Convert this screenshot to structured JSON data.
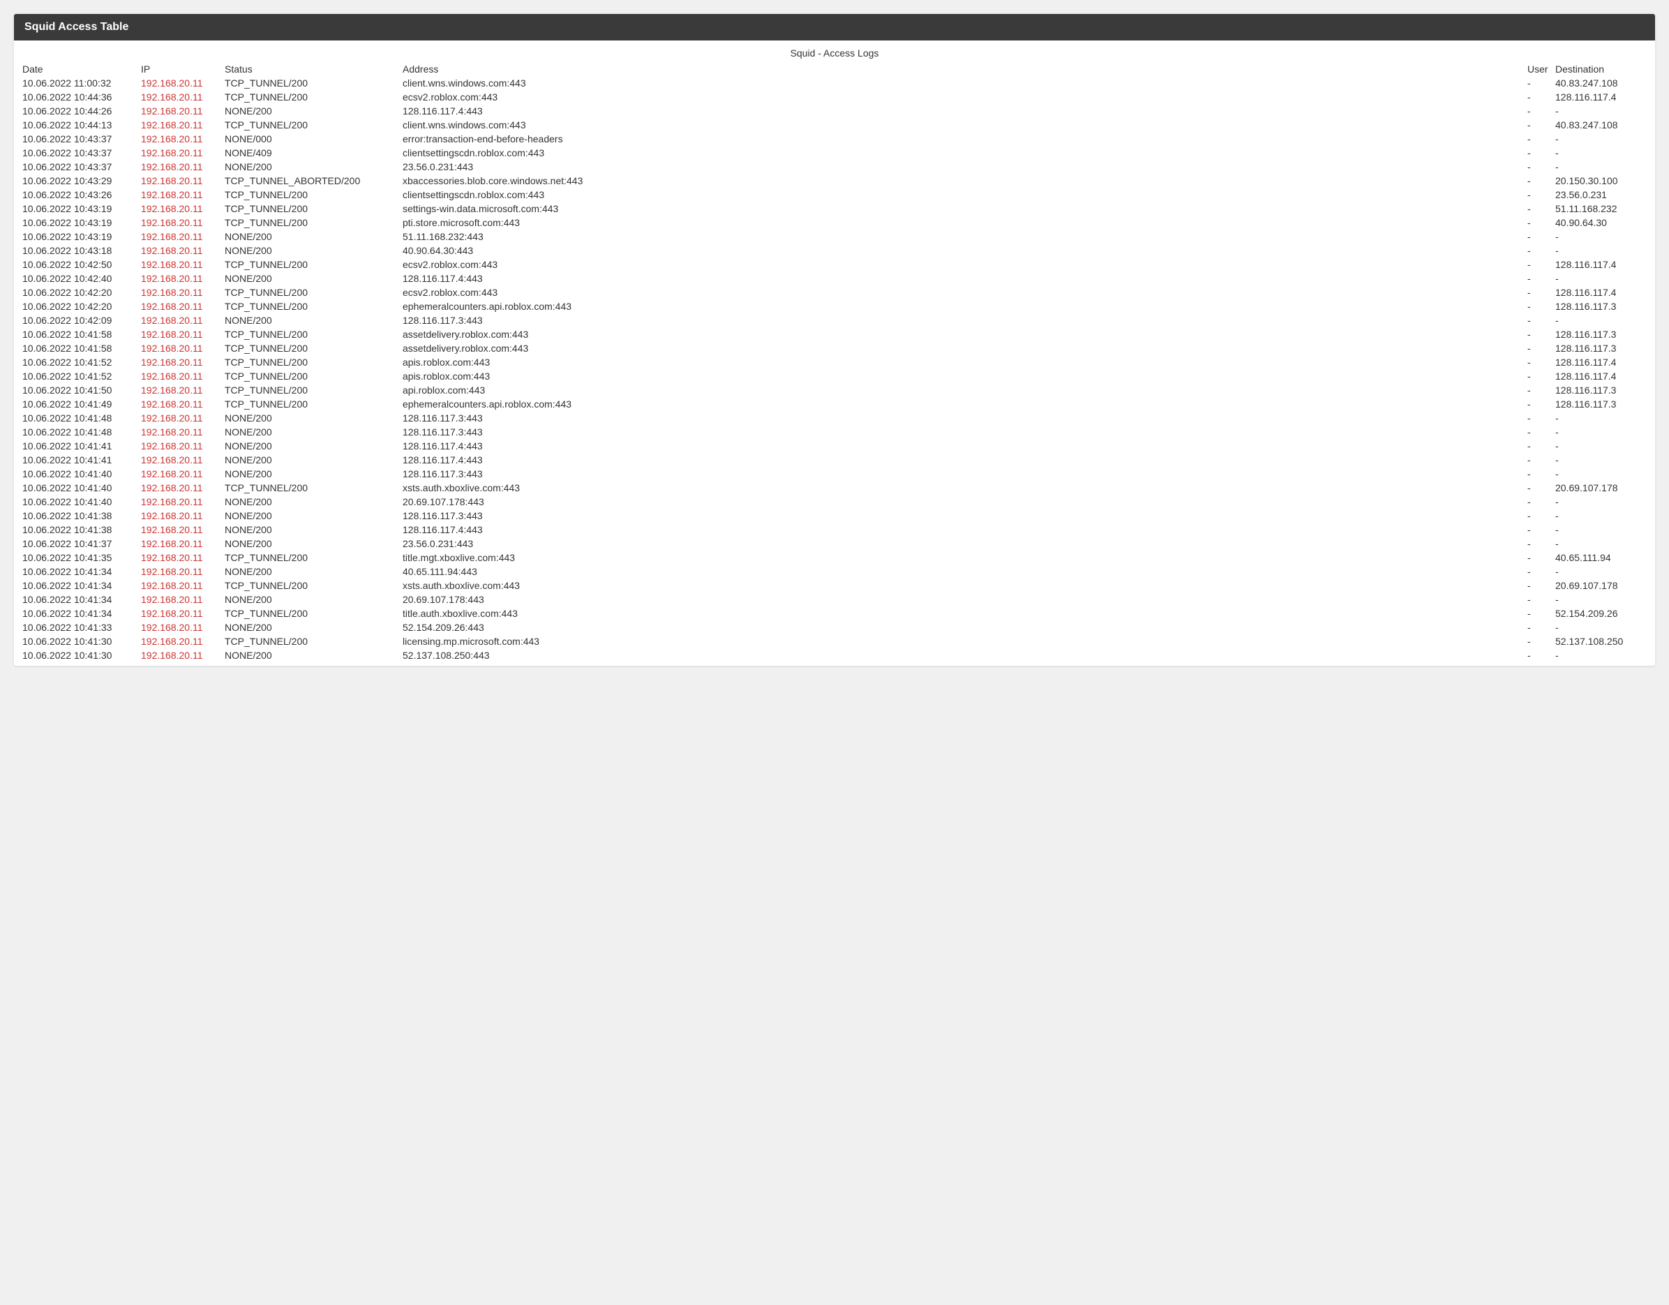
{
  "panel": {
    "title": "Squid Access Table",
    "subtitle": "Squid - Access Logs"
  },
  "columns": {
    "date": "Date",
    "ip": "IP",
    "status": "Status",
    "address": "Address",
    "user": "User",
    "destination": "Destination"
  },
  "rows": [
    {
      "date": "10.06.2022 11:00:32",
      "ip": "192.168.20.11",
      "status": "TCP_TUNNEL/200",
      "address": "client.wns.windows.com:443",
      "user": "-",
      "dest": "40.83.247.108"
    },
    {
      "date": "10.06.2022 10:44:36",
      "ip": "192.168.20.11",
      "status": "TCP_TUNNEL/200",
      "address": "ecsv2.roblox.com:443",
      "user": "-",
      "dest": "128.116.117.4"
    },
    {
      "date": "10.06.2022 10:44:26",
      "ip": "192.168.20.11",
      "status": "NONE/200",
      "address": "128.116.117.4:443",
      "user": "-",
      "dest": "-"
    },
    {
      "date": "10.06.2022 10:44:13",
      "ip": "192.168.20.11",
      "status": "TCP_TUNNEL/200",
      "address": "client.wns.windows.com:443",
      "user": "-",
      "dest": "40.83.247.108"
    },
    {
      "date": "10.06.2022 10:43:37",
      "ip": "192.168.20.11",
      "status": "NONE/000",
      "address": "error:transaction-end-before-headers",
      "user": "-",
      "dest": "-"
    },
    {
      "date": "10.06.2022 10:43:37",
      "ip": "192.168.20.11",
      "status": "NONE/409",
      "address": "clientsettingscdn.roblox.com:443",
      "user": "-",
      "dest": "-"
    },
    {
      "date": "10.06.2022 10:43:37",
      "ip": "192.168.20.11",
      "status": "NONE/200",
      "address": "23.56.0.231:443",
      "user": "-",
      "dest": "-"
    },
    {
      "date": "10.06.2022 10:43:29",
      "ip": "192.168.20.11",
      "status": "TCP_TUNNEL_ABORTED/200",
      "address": "xbaccessories.blob.core.windows.net:443",
      "user": "-",
      "dest": "20.150.30.100"
    },
    {
      "date": "10.06.2022 10:43:26",
      "ip": "192.168.20.11",
      "status": "TCP_TUNNEL/200",
      "address": "clientsettingscdn.roblox.com:443",
      "user": "-",
      "dest": "23.56.0.231"
    },
    {
      "date": "10.06.2022 10:43:19",
      "ip": "192.168.20.11",
      "status": "TCP_TUNNEL/200",
      "address": "settings-win.data.microsoft.com:443",
      "user": "-",
      "dest": "51.11.168.232"
    },
    {
      "date": "10.06.2022 10:43:19",
      "ip": "192.168.20.11",
      "status": "TCP_TUNNEL/200",
      "address": "pti.store.microsoft.com:443",
      "user": "-",
      "dest": "40.90.64.30"
    },
    {
      "date": "10.06.2022 10:43:19",
      "ip": "192.168.20.11",
      "status": "NONE/200",
      "address": "51.11.168.232:443",
      "user": "-",
      "dest": "-"
    },
    {
      "date": "10.06.2022 10:43:18",
      "ip": "192.168.20.11",
      "status": "NONE/200",
      "address": "40.90.64.30:443",
      "user": "-",
      "dest": "-"
    },
    {
      "date": "10.06.2022 10:42:50",
      "ip": "192.168.20.11",
      "status": "TCP_TUNNEL/200",
      "address": "ecsv2.roblox.com:443",
      "user": "-",
      "dest": "128.116.117.4"
    },
    {
      "date": "10.06.2022 10:42:40",
      "ip": "192.168.20.11",
      "status": "NONE/200",
      "address": "128.116.117.4:443",
      "user": "-",
      "dest": "-"
    },
    {
      "date": "10.06.2022 10:42:20",
      "ip": "192.168.20.11",
      "status": "TCP_TUNNEL/200",
      "address": "ecsv2.roblox.com:443",
      "user": "-",
      "dest": "128.116.117.4"
    },
    {
      "date": "10.06.2022 10:42:20",
      "ip": "192.168.20.11",
      "status": "TCP_TUNNEL/200",
      "address": "ephemeralcounters.api.roblox.com:443",
      "user": "-",
      "dest": "128.116.117.3"
    },
    {
      "date": "10.06.2022 10:42:09",
      "ip": "192.168.20.11",
      "status": "NONE/200",
      "address": "128.116.117.3:443",
      "user": "-",
      "dest": "-"
    },
    {
      "date": "10.06.2022 10:41:58",
      "ip": "192.168.20.11",
      "status": "TCP_TUNNEL/200",
      "address": "assetdelivery.roblox.com:443",
      "user": "-",
      "dest": "128.116.117.3"
    },
    {
      "date": "10.06.2022 10:41:58",
      "ip": "192.168.20.11",
      "status": "TCP_TUNNEL/200",
      "address": "assetdelivery.roblox.com:443",
      "user": "-",
      "dest": "128.116.117.3"
    },
    {
      "date": "10.06.2022 10:41:52",
      "ip": "192.168.20.11",
      "status": "TCP_TUNNEL/200",
      "address": "apis.roblox.com:443",
      "user": "-",
      "dest": "128.116.117.4"
    },
    {
      "date": "10.06.2022 10:41:52",
      "ip": "192.168.20.11",
      "status": "TCP_TUNNEL/200",
      "address": "apis.roblox.com:443",
      "user": "-",
      "dest": "128.116.117.4"
    },
    {
      "date": "10.06.2022 10:41:50",
      "ip": "192.168.20.11",
      "status": "TCP_TUNNEL/200",
      "address": "api.roblox.com:443",
      "user": "-",
      "dest": "128.116.117.3"
    },
    {
      "date": "10.06.2022 10:41:49",
      "ip": "192.168.20.11",
      "status": "TCP_TUNNEL/200",
      "address": "ephemeralcounters.api.roblox.com:443",
      "user": "-",
      "dest": "128.116.117.3"
    },
    {
      "date": "10.06.2022 10:41:48",
      "ip": "192.168.20.11",
      "status": "NONE/200",
      "address": "128.116.117.3:443",
      "user": "-",
      "dest": "-"
    },
    {
      "date": "10.06.2022 10:41:48",
      "ip": "192.168.20.11",
      "status": "NONE/200",
      "address": "128.116.117.3:443",
      "user": "-",
      "dest": "-"
    },
    {
      "date": "10.06.2022 10:41:41",
      "ip": "192.168.20.11",
      "status": "NONE/200",
      "address": "128.116.117.4:443",
      "user": "-",
      "dest": "-"
    },
    {
      "date": "10.06.2022 10:41:41",
      "ip": "192.168.20.11",
      "status": "NONE/200",
      "address": "128.116.117.4:443",
      "user": "-",
      "dest": "-"
    },
    {
      "date": "10.06.2022 10:41:40",
      "ip": "192.168.20.11",
      "status": "NONE/200",
      "address": "128.116.117.3:443",
      "user": "-",
      "dest": "-"
    },
    {
      "date": "10.06.2022 10:41:40",
      "ip": "192.168.20.11",
      "status": "TCP_TUNNEL/200",
      "address": "xsts.auth.xboxlive.com:443",
      "user": "-",
      "dest": "20.69.107.178"
    },
    {
      "date": "10.06.2022 10:41:40",
      "ip": "192.168.20.11",
      "status": "NONE/200",
      "address": "20.69.107.178:443",
      "user": "-",
      "dest": "-"
    },
    {
      "date": "10.06.2022 10:41:38",
      "ip": "192.168.20.11",
      "status": "NONE/200",
      "address": "128.116.117.3:443",
      "user": "-",
      "dest": "-"
    },
    {
      "date": "10.06.2022 10:41:38",
      "ip": "192.168.20.11",
      "status": "NONE/200",
      "address": "128.116.117.4:443",
      "user": "-",
      "dest": "-"
    },
    {
      "date": "10.06.2022 10:41:37",
      "ip": "192.168.20.11",
      "status": "NONE/200",
      "address": "23.56.0.231:443",
      "user": "-",
      "dest": "-"
    },
    {
      "date": "10.06.2022 10:41:35",
      "ip": "192.168.20.11",
      "status": "TCP_TUNNEL/200",
      "address": "title.mgt.xboxlive.com:443",
      "user": "-",
      "dest": "40.65.111.94"
    },
    {
      "date": "10.06.2022 10:41:34",
      "ip": "192.168.20.11",
      "status": "NONE/200",
      "address": "40.65.111.94:443",
      "user": "-",
      "dest": "-"
    },
    {
      "date": "10.06.2022 10:41:34",
      "ip": "192.168.20.11",
      "status": "TCP_TUNNEL/200",
      "address": "xsts.auth.xboxlive.com:443",
      "user": "-",
      "dest": "20.69.107.178"
    },
    {
      "date": "10.06.2022 10:41:34",
      "ip": "192.168.20.11",
      "status": "NONE/200",
      "address": "20.69.107.178:443",
      "user": "-",
      "dest": "-"
    },
    {
      "date": "10.06.2022 10:41:34",
      "ip": "192.168.20.11",
      "status": "TCP_TUNNEL/200",
      "address": "title.auth.xboxlive.com:443",
      "user": "-",
      "dest": "52.154.209.26"
    },
    {
      "date": "10.06.2022 10:41:33",
      "ip": "192.168.20.11",
      "status": "NONE/200",
      "address": "52.154.209.26:443",
      "user": "-",
      "dest": "-"
    },
    {
      "date": "10.06.2022 10:41:30",
      "ip": "192.168.20.11",
      "status": "TCP_TUNNEL/200",
      "address": "licensing.mp.microsoft.com:443",
      "user": "-",
      "dest": "52.137.108.250"
    },
    {
      "date": "10.06.2022 10:41:30",
      "ip": "192.168.20.11",
      "status": "NONE/200",
      "address": "52.137.108.250:443",
      "user": "-",
      "dest": "-"
    }
  ]
}
